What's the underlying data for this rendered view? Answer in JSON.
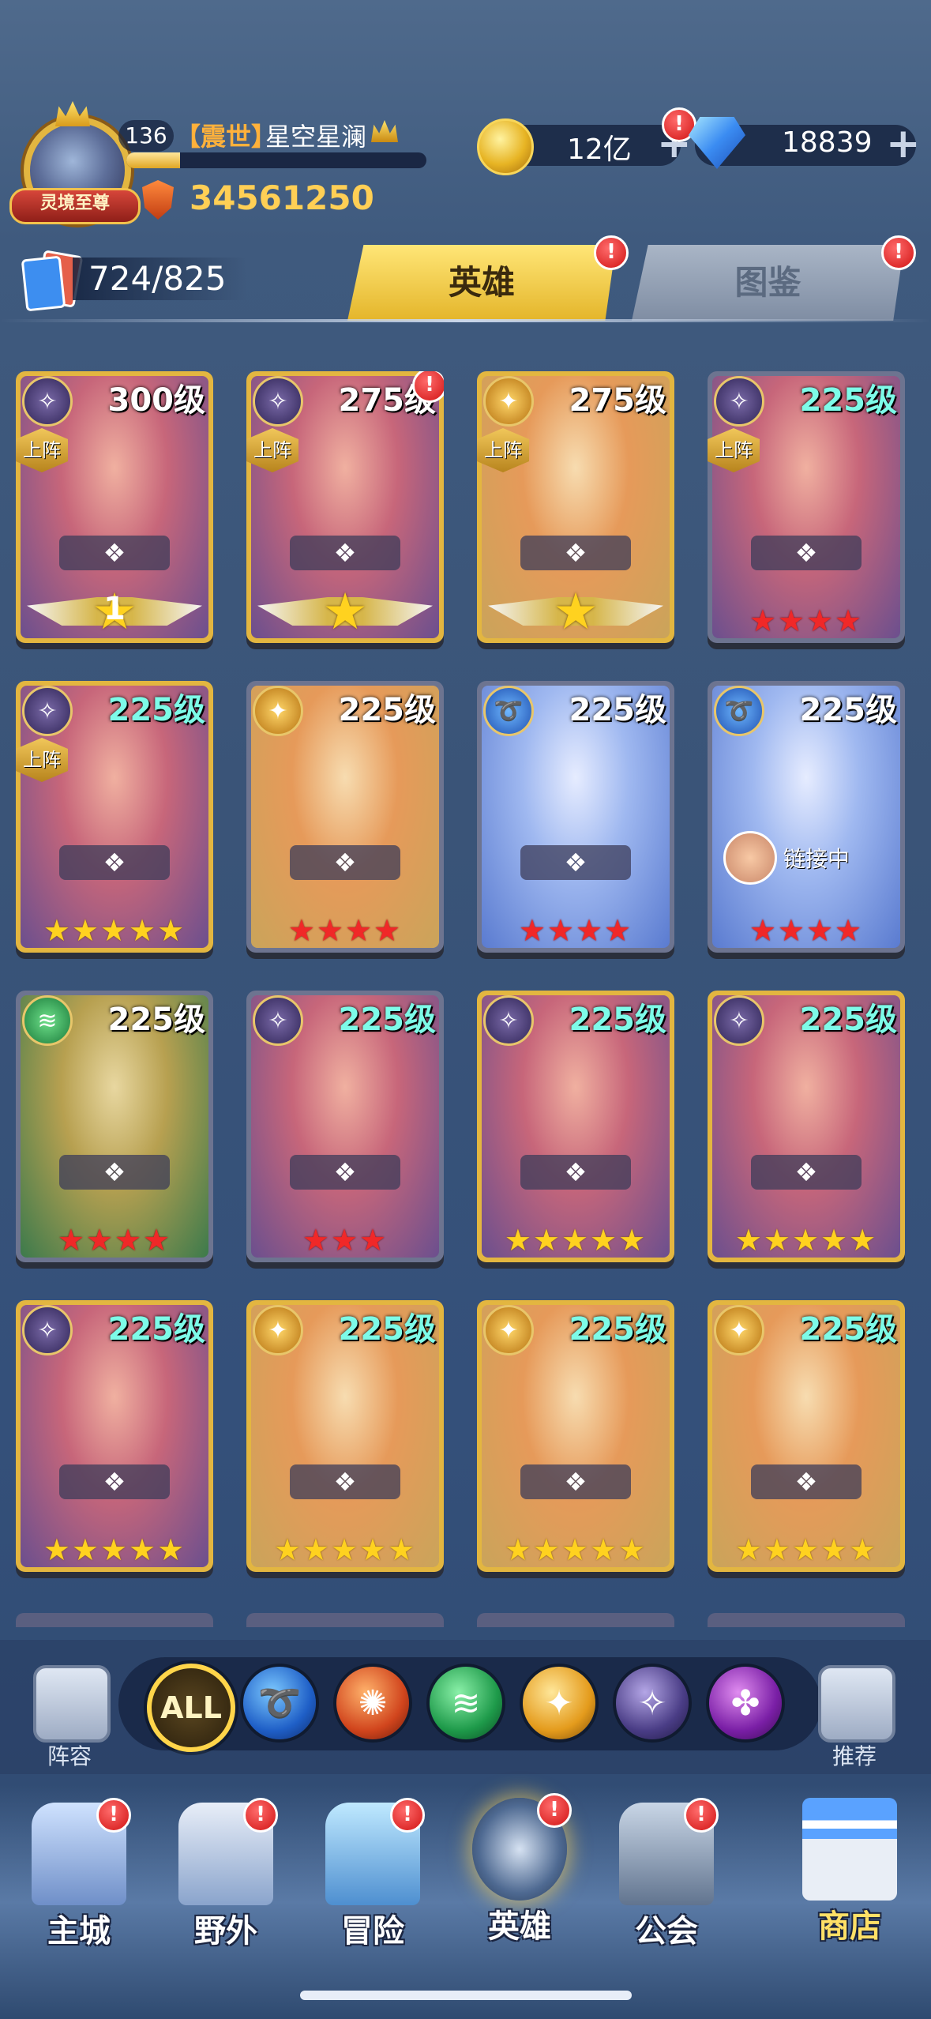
{
  "player": {
    "title_badge": "灵境至尊",
    "level": "136",
    "guild_tag": "【震世】",
    "name": "星空星澜",
    "exp_fraction": 0.18,
    "power": "34561250"
  },
  "resources": {
    "gold": "12亿",
    "diamonds": "18839",
    "plus": "+"
  },
  "hero_count": "724/825",
  "tabs": [
    "英雄",
    "图鉴"
  ],
  "alert": "!",
  "heroes": [
    {
      "level": "300级",
      "on_team": "上阵",
      "star_count": "1",
      "stars": "big",
      "faction": "shadow",
      "level_color": "white"
    },
    {
      "level": "275级",
      "on_team": "上阵",
      "stars": "big",
      "faction": "shadow",
      "level_color": "white",
      "alert": true
    },
    {
      "level": "275级",
      "on_team": "上阵",
      "stars": "big",
      "faction": "light",
      "level_color": "white"
    },
    {
      "level": "225级",
      "on_team": "上阵",
      "stars": "★★★★",
      "star_color": "red",
      "faction": "shadow",
      "level_color": "cyan"
    },
    {
      "level": "225级",
      "on_team": "上阵",
      "stars": "★★★★★",
      "star_color": "gold",
      "faction": "shadow",
      "level_color": "cyan"
    },
    {
      "level": "225级",
      "stars": "★★★★",
      "star_color": "red",
      "faction": "light",
      "level_color": "white"
    },
    {
      "level": "225级",
      "stars": "★★★★",
      "star_color": "red",
      "faction": "water",
      "level_color": "white"
    },
    {
      "level": "225级",
      "stars": "★★★★",
      "star_color": "red",
      "faction": "water",
      "level_color": "white",
      "linked": "链接中"
    },
    {
      "level": "225级",
      "stars": "★★★★",
      "star_color": "red",
      "faction": "wind",
      "level_color": "white"
    },
    {
      "level": "225级",
      "stars": "★★★",
      "star_color": "red",
      "faction": "shadow",
      "level_color": "cyan"
    },
    {
      "level": "225级",
      "stars": "★★★★★",
      "star_color": "gold",
      "faction": "shadow",
      "level_color": "cyan"
    },
    {
      "level": "225级",
      "stars": "★★★★★",
      "star_color": "gold",
      "faction": "shadow",
      "level_color": "cyan"
    },
    {
      "level": "225级",
      "stars": "★★★★★",
      "star_color": "gold",
      "faction": "shadow",
      "level_color": "cyan"
    },
    {
      "level": "225级",
      "stars": "★★★★★",
      "star_color": "gold",
      "faction": "light",
      "level_color": "cyan"
    },
    {
      "level": "225级",
      "stars": "★★★★★",
      "star_color": "gold",
      "faction": "light",
      "level_color": "cyan"
    },
    {
      "level": "225级",
      "stars": "★★★★★",
      "star_color": "gold",
      "faction": "light",
      "level_color": "cyan"
    }
  ],
  "filter": {
    "lineup_label": "阵容",
    "recommend_label": "推荐",
    "all_label": "ALL",
    "factions": [
      "water",
      "fire",
      "wind",
      "light",
      "shadow",
      "chaos"
    ]
  },
  "nav": [
    {
      "label": "主城",
      "alert": true
    },
    {
      "label": "野外",
      "alert": true
    },
    {
      "label": "冒险",
      "alert": true
    },
    {
      "label": "英雄",
      "alert": true,
      "active": true
    },
    {
      "label": "公会",
      "alert": true
    },
    {
      "label": "商店",
      "alert": false
    }
  ]
}
